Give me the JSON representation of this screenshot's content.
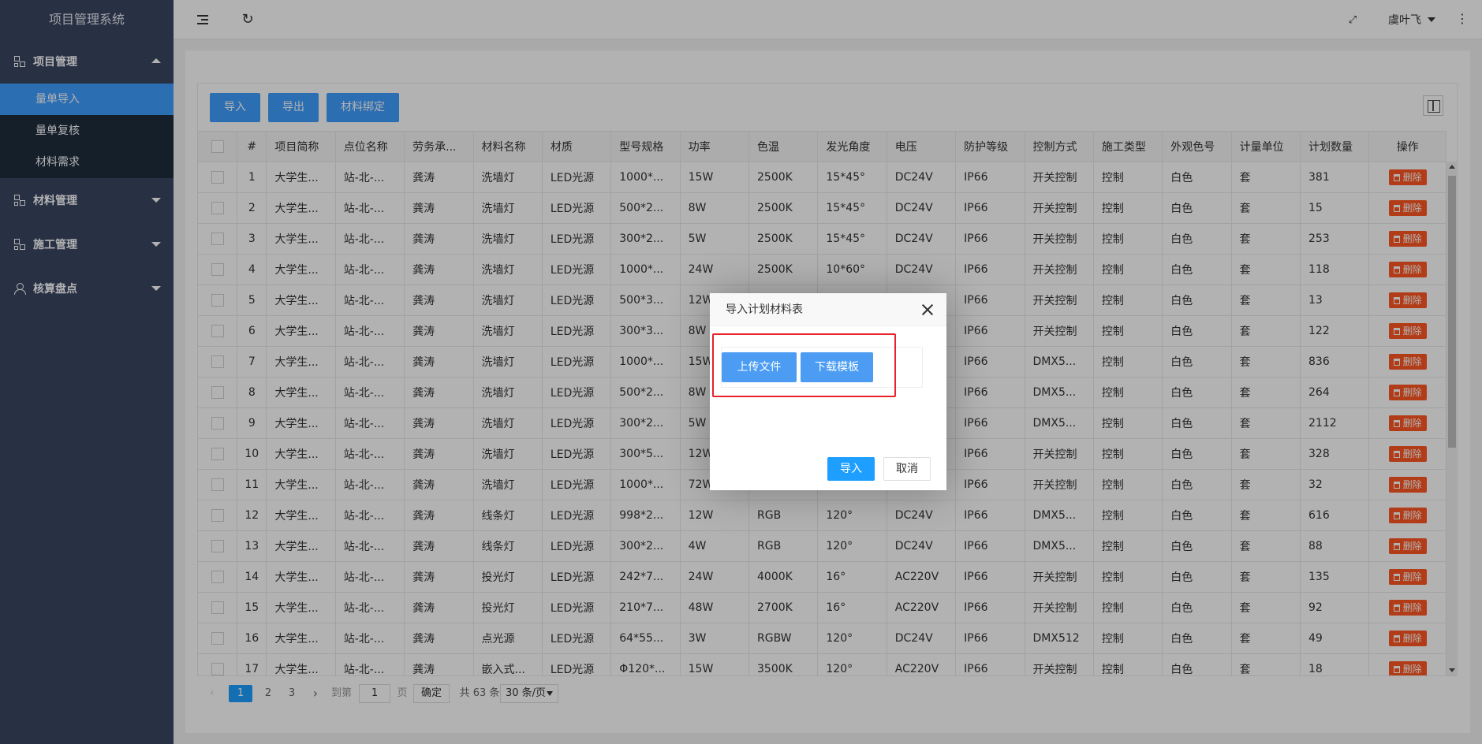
{
  "app": {
    "title": "项目管理系统"
  },
  "sidebar": {
    "groups": [
      {
        "label": "项目管理",
        "expanded": true,
        "items": [
          "量单导入",
          "量单复核",
          "材料需求"
        ],
        "active": "量单导入"
      },
      {
        "label": "材料管理",
        "expanded": false
      },
      {
        "label": "施工管理",
        "expanded": false
      },
      {
        "label": "核算盘点",
        "expanded": false
      }
    ]
  },
  "header": {
    "user": "虞叶飞"
  },
  "toolbar": {
    "import": "导入",
    "export": "导出",
    "bind": "材料绑定"
  },
  "table": {
    "columns": [
      "#",
      "项目简称",
      "点位名称",
      "劳务承...",
      "材料名称",
      "材质",
      "型号规格",
      "功率",
      "色温",
      "发光角度",
      "电压",
      "防护等级",
      "控制方式",
      "施工类型",
      "外观色号",
      "计量单位",
      "计划数量",
      "操作"
    ],
    "rows": [
      [
        "1",
        "大学生...",
        "站-北-...",
        "龚涛",
        "洗墙灯",
        "LED光源",
        "1000*...",
        "15W",
        "2500K",
        "15*45°",
        "DC24V",
        "IP66",
        "开关控制",
        "控制",
        "白色",
        "套",
        "381"
      ],
      [
        "2",
        "大学生...",
        "站-北-...",
        "龚涛",
        "洗墙灯",
        "LED光源",
        "500*2...",
        "8W",
        "2500K",
        "15*45°",
        "DC24V",
        "IP66",
        "开关控制",
        "控制",
        "白色",
        "套",
        "15"
      ],
      [
        "3",
        "大学生...",
        "站-北-...",
        "龚涛",
        "洗墙灯",
        "LED光源",
        "300*2...",
        "5W",
        "2500K",
        "15*45°",
        "DC24V",
        "IP66",
        "开关控制",
        "控制",
        "白色",
        "套",
        "253"
      ],
      [
        "4",
        "大学生...",
        "站-北-...",
        "龚涛",
        "洗墙灯",
        "LED光源",
        "1000*...",
        "24W",
        "2500K",
        "10*60°",
        "DC24V",
        "IP66",
        "开关控制",
        "控制",
        "白色",
        "套",
        "118"
      ],
      [
        "5",
        "大学生...",
        "站-北-...",
        "龚涛",
        "洗墙灯",
        "LED光源",
        "500*3...",
        "12W",
        "",
        "",
        "",
        "IP66",
        "开关控制",
        "控制",
        "白色",
        "套",
        "13"
      ],
      [
        "6",
        "大学生...",
        "站-北-...",
        "龚涛",
        "洗墙灯",
        "LED光源",
        "300*3...",
        "8W",
        "",
        "",
        "",
        "IP66",
        "开关控制",
        "控制",
        "白色",
        "套",
        "122"
      ],
      [
        "7",
        "大学生...",
        "站-北-...",
        "龚涛",
        "洗墙灯",
        "LED光源",
        "1000*...",
        "15W",
        "",
        "",
        "",
        "IP66",
        "DMX5...",
        "控制",
        "白色",
        "套",
        "836"
      ],
      [
        "8",
        "大学生...",
        "站-北-...",
        "龚涛",
        "洗墙灯",
        "LED光源",
        "500*2...",
        "8W",
        "",
        "",
        "",
        "IP66",
        "DMX5...",
        "控制",
        "白色",
        "套",
        "264"
      ],
      [
        "9",
        "大学生...",
        "站-北-...",
        "龚涛",
        "洗墙灯",
        "LED光源",
        "300*2...",
        "5W",
        "",
        "",
        "",
        "IP66",
        "DMX5...",
        "控制",
        "白色",
        "套",
        "2112"
      ],
      [
        "10",
        "大学生...",
        "站-北-...",
        "龚涛",
        "洗墙灯",
        "LED光源",
        "300*5...",
        "12W",
        "",
        "",
        "",
        "IP66",
        "开关控制",
        "控制",
        "白色",
        "套",
        "328"
      ],
      [
        "11",
        "大学生...",
        "站-北-...",
        "龚涛",
        "洗墙灯",
        "LED光源",
        "1000*...",
        "72W",
        "",
        "",
        "",
        "IP66",
        "开关控制",
        "控制",
        "白色",
        "套",
        "32"
      ],
      [
        "12",
        "大学生...",
        "站-北-...",
        "龚涛",
        "线条灯",
        "LED光源",
        "998*2...",
        "12W",
        "RGB",
        "120°",
        "DC24V",
        "IP66",
        "DMX5...",
        "控制",
        "白色",
        "套",
        "616"
      ],
      [
        "13",
        "大学生...",
        "站-北-...",
        "龚涛",
        "线条灯",
        "LED光源",
        "300*2...",
        "4W",
        "RGB",
        "120°",
        "DC24V",
        "IP66",
        "DMX5...",
        "控制",
        "白色",
        "套",
        "88"
      ],
      [
        "14",
        "大学生...",
        "站-北-...",
        "龚涛",
        "投光灯",
        "LED光源",
        "242*7...",
        "24W",
        "4000K",
        "16°",
        "AC220V",
        "IP66",
        "开关控制",
        "控制",
        "白色",
        "套",
        "135"
      ],
      [
        "15",
        "大学生...",
        "站-北-...",
        "龚涛",
        "投光灯",
        "LED光源",
        "210*7...",
        "48W",
        "2700K",
        "16°",
        "AC220V",
        "IP66",
        "开关控制",
        "控制",
        "白色",
        "套",
        "92"
      ],
      [
        "16",
        "大学生...",
        "站-北-...",
        "龚涛",
        "点光源",
        "LED光源",
        "64*55...",
        "3W",
        "RGBW",
        "120°",
        "DC24V",
        "IP66",
        "DMX512",
        "控制",
        "白色",
        "套",
        "49"
      ],
      [
        "17",
        "大学生...",
        "站-北-...",
        "龚涛",
        "嵌入式...",
        "LED光源",
        "Φ120*...",
        "15W",
        "3500K",
        "120°",
        "AC220V",
        "IP66",
        "开关控制",
        "控制",
        "白色",
        "套",
        "18"
      ]
    ],
    "delete_label": "删除"
  },
  "pager": {
    "pages": [
      "1",
      "2",
      "3"
    ],
    "goto_prefix": "到第",
    "goto_value": "1",
    "goto_suffix": "页",
    "confirm": "确定",
    "total": "共 63 条",
    "page_size": "30 条/页"
  },
  "dialog": {
    "title": "导入计划材料表",
    "upload": "上传文件",
    "download": "下载模板",
    "ok": "导入",
    "cancel": "取消"
  },
  "colors": {
    "accent": "#409eff",
    "danger": "#ff5722",
    "sidebar_bg": "#3a4662",
    "highlight": "#e8222a"
  }
}
